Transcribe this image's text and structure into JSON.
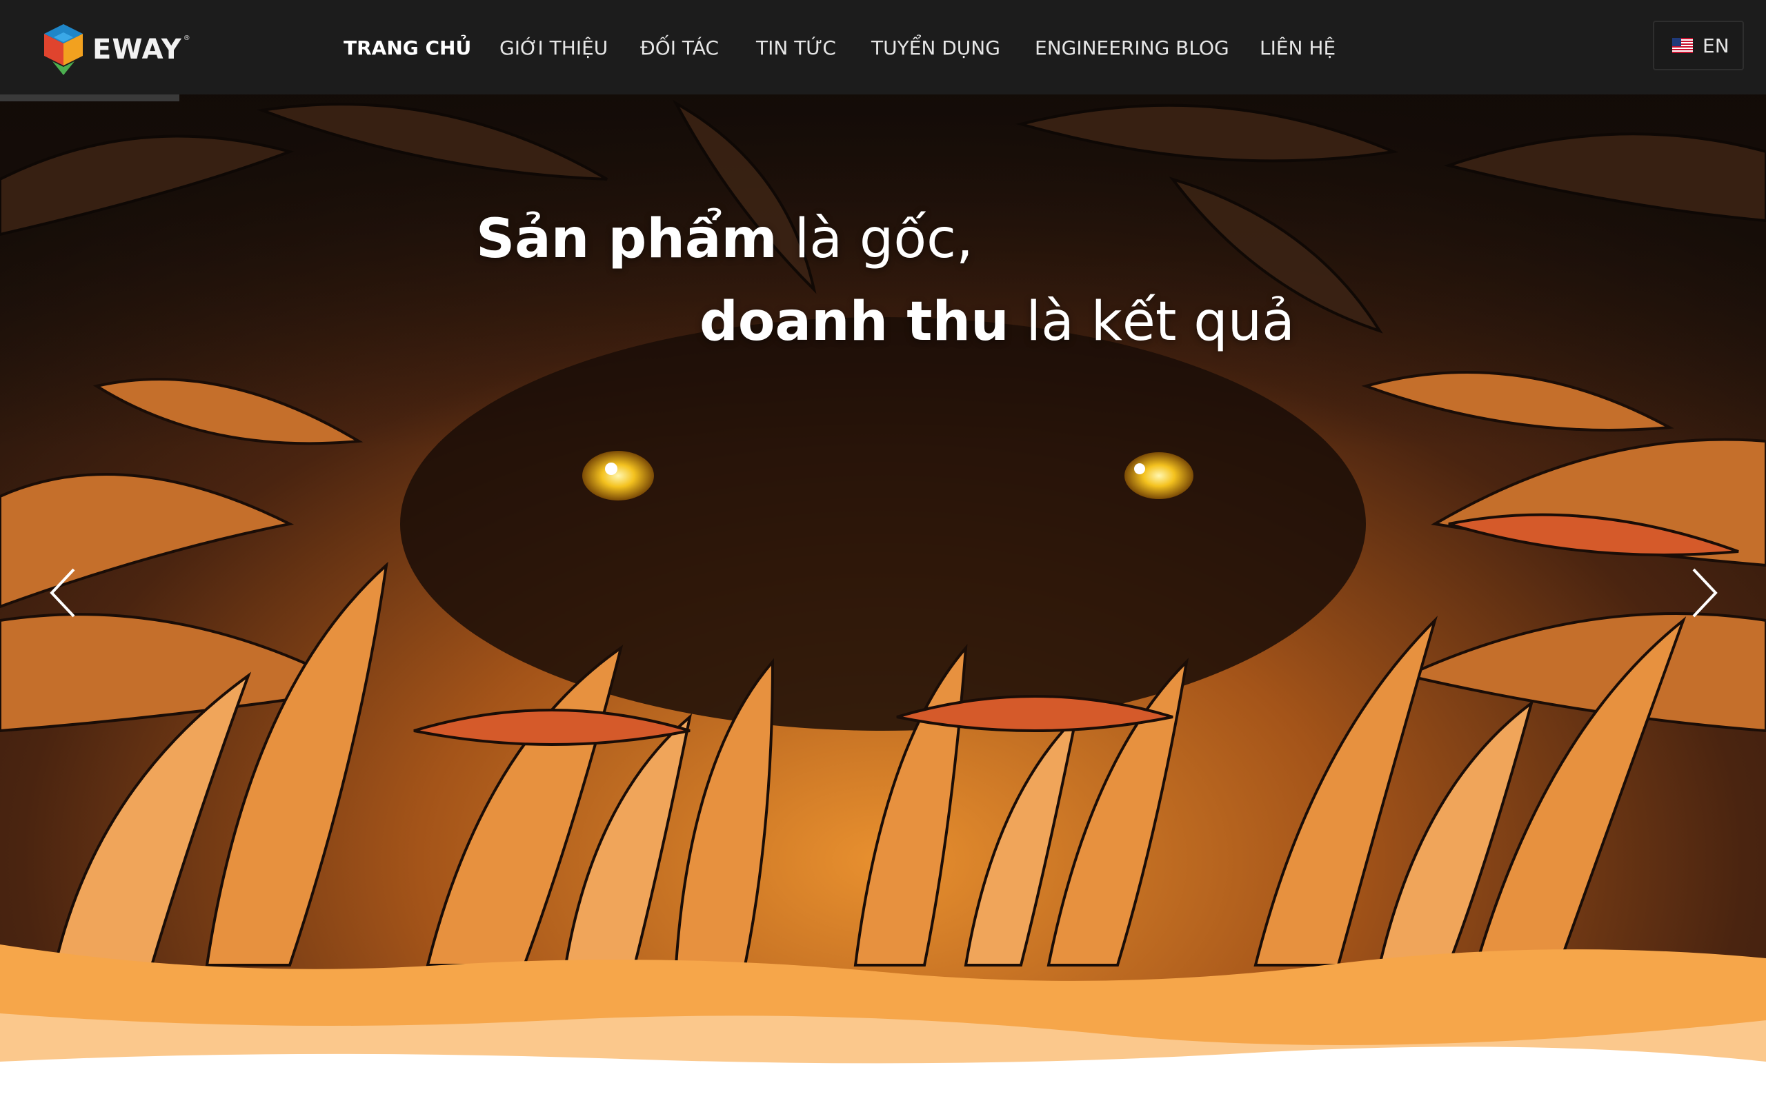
{
  "brand": {
    "name": "EWAY",
    "registered_mark": "®"
  },
  "nav": {
    "items": [
      {
        "label": "TRANG CHỦ",
        "active": true
      },
      {
        "label": "GIỚI THIỆU",
        "active": false
      },
      {
        "label": "ĐỐI TÁC",
        "active": false
      },
      {
        "label": "TIN TỨC",
        "active": false
      },
      {
        "label": "TUYỂN DỤNG",
        "active": false
      },
      {
        "label": "ENGINEERING BLOG",
        "active": false
      },
      {
        "label": "LIÊN HỆ",
        "active": false
      }
    ],
    "language": {
      "label": "EN",
      "flag_icon": "us-flag-icon"
    }
  },
  "hero": {
    "line1": {
      "bold": "Sản phẩm",
      "light": " là gốc,"
    },
    "line2": {
      "bold": "doanh thu",
      "light": " là kết quả"
    },
    "prev_icon": "chevron-left-icon",
    "next_icon": "chevron-right-icon"
  },
  "colors": {
    "navbar_bg": "#1c1c1c",
    "hero_dark": "#1e120a",
    "hero_orange": "#d9822b",
    "wave_orange": "#f6a64a",
    "text_white": "#ffffff"
  }
}
